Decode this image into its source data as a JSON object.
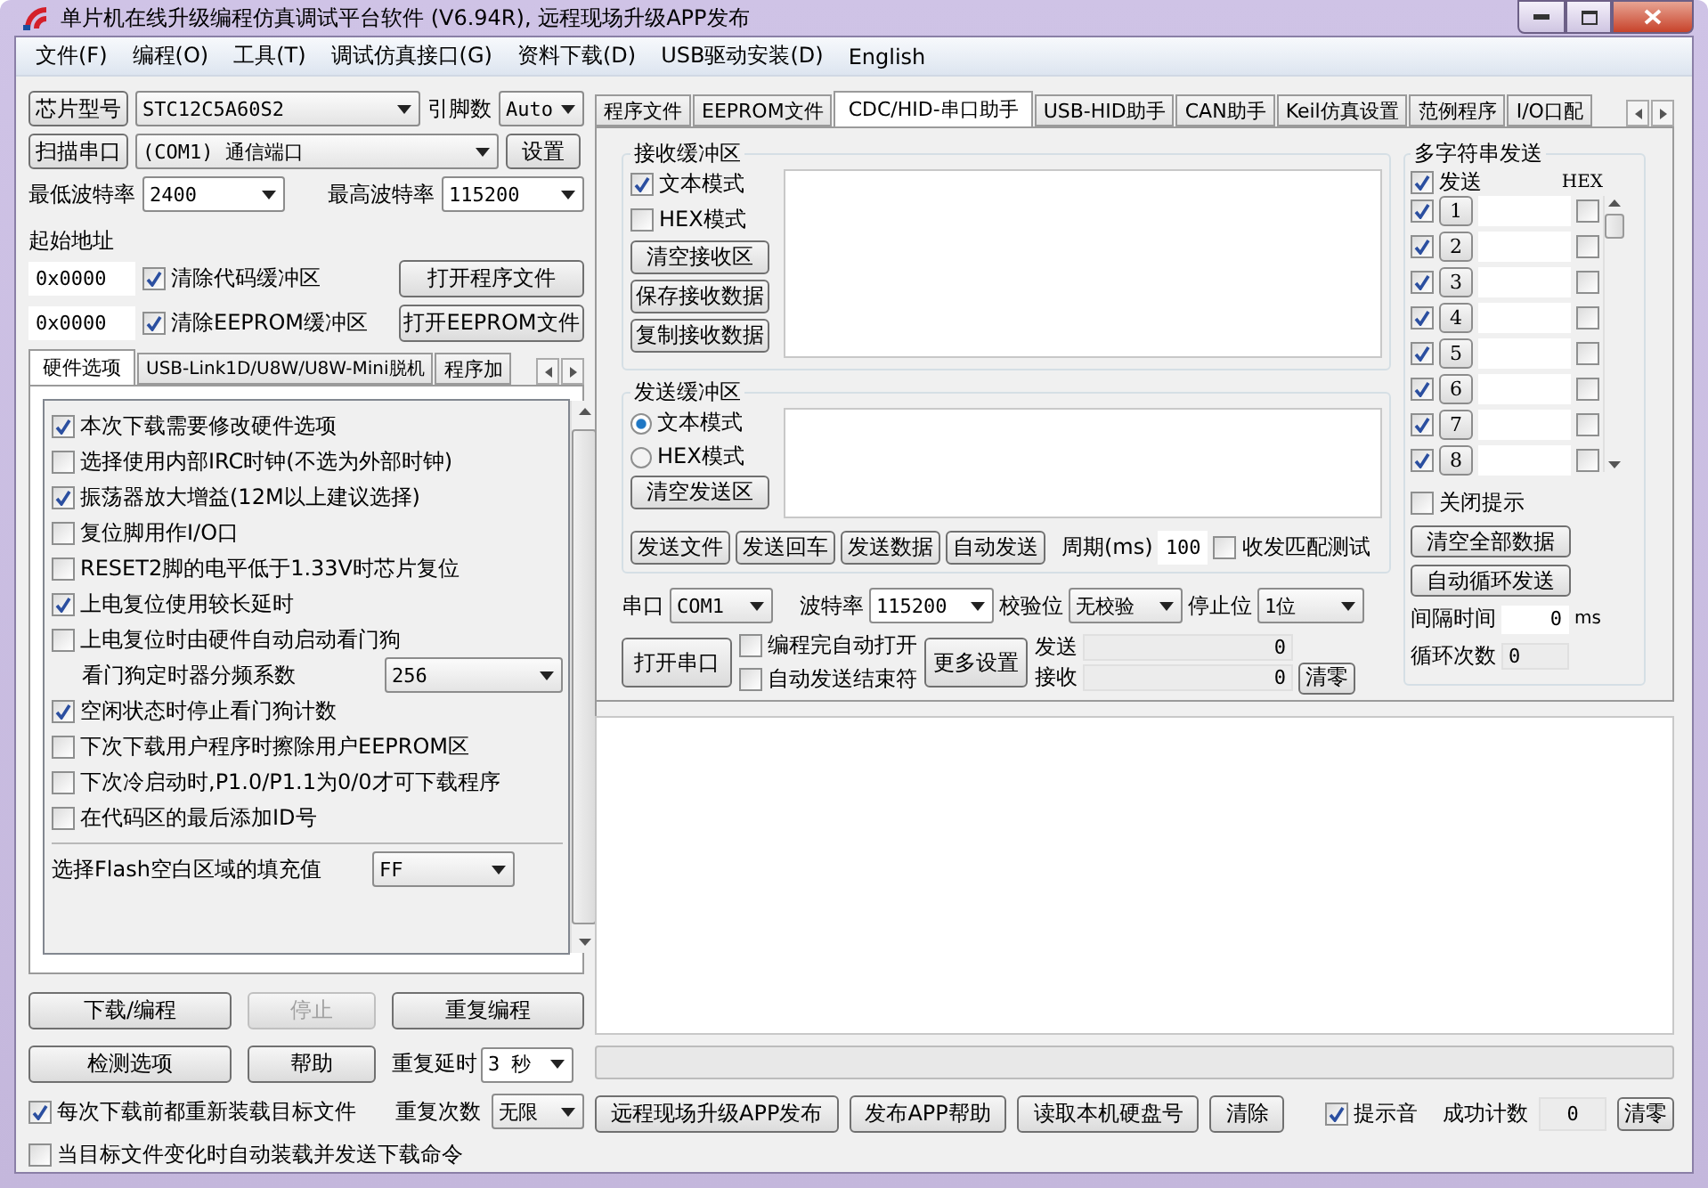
{
  "window": {
    "title": "单片机在线升级编程仿真调试平台软件 (V6.94R), 远程现场升级APP发布"
  },
  "menu": [
    "文件(F)",
    "编程(O)",
    "工具(T)",
    "调试仿真接口(G)",
    "资料下载(D)",
    "USB驱动安装(D)",
    "English"
  ],
  "chip": {
    "button": "芯片型号",
    "value": "STC12C5A60S2",
    "pins_label": "引脚数",
    "pins": "Auto"
  },
  "port": {
    "button": "扫描串口",
    "value": "(COM1) 通信端口",
    "settings": "设置"
  },
  "baud": {
    "min_label": "最低波特率",
    "min": "2400",
    "max_label": "最高波特率",
    "max": "115200"
  },
  "start_address": {
    "label": "起始地址",
    "rows": [
      {
        "address": "0x0000",
        "label": "清除代码缓冲区",
        "checked": true,
        "button": "打开程序文件"
      },
      {
        "address": "0x0000",
        "label": "清除EEPROM缓冲区",
        "checked": true,
        "button": "打开EEPROM文件"
      }
    ]
  },
  "left_tabs": [
    {
      "label": "硬件选项",
      "selected": true
    },
    {
      "label": "USB-Link1D/U8W/U8W-Mini脱机",
      "selected": false
    },
    {
      "label": "程序加",
      "selected": false
    }
  ],
  "hardware_options": [
    {
      "kind": "checkbox",
      "label": "本次下载需要修改硬件选项",
      "checked": true
    },
    {
      "kind": "checkbox",
      "label": "选择使用内部IRC时钟(不选为外部时钟)",
      "checked": false
    },
    {
      "kind": "checkbox",
      "label": "振荡器放大增益(12M以上建议选择)",
      "checked": true
    },
    {
      "kind": "checkbox",
      "label": "复位脚用作I/O口",
      "checked": false
    },
    {
      "kind": "checkbox",
      "label": "RESET2脚的电平低于1.33V时芯片复位",
      "checked": false
    },
    {
      "kind": "checkbox",
      "label": "上电复位使用较长延时",
      "checked": true
    },
    {
      "kind": "checkbox",
      "label": "上电复位时由硬件自动启动看门狗",
      "checked": false
    },
    {
      "kind": "select",
      "label": "看门狗定时器分频系数",
      "value": "256"
    },
    {
      "kind": "checkbox",
      "label": "空闲状态时停止看门狗计数",
      "checked": true
    },
    {
      "kind": "checkbox",
      "label": "下次下载用户程序时擦除用户EEPROM区",
      "checked": false
    },
    {
      "kind": "checkbox",
      "label": "下次冷启动时,P1.0/P1.1为0/0才可下载程序",
      "checked": false
    },
    {
      "kind": "checkbox",
      "label": "在代码区的最后添加ID号",
      "checked": false
    }
  ],
  "fill_value": {
    "label": "选择Flash空白区域的填充值",
    "value": "FF"
  },
  "actions": [
    {
      "label": "下载/编程",
      "disabled": false
    },
    {
      "label": "停止",
      "disabled": true
    },
    {
      "label": "重复编程",
      "disabled": false
    },
    {
      "label": "检测选项",
      "disabled": false
    },
    {
      "label": "帮助",
      "disabled": false
    }
  ],
  "repeat_delay": {
    "label": "重复延时",
    "value": "3 秒"
  },
  "repeat_count": {
    "label": "重复次数",
    "value": "无限"
  },
  "reload_options": [
    {
      "label": "每次下载前都重新装载目标文件",
      "checked": true
    },
    {
      "label": "当目标文件变化时自动装载并发送下载命令",
      "checked": false
    }
  ],
  "right_tabs": [
    {
      "label": "程序文件",
      "selected": false
    },
    {
      "label": "EEPROM文件",
      "selected": false
    },
    {
      "label": "CDC/HID-串口助手",
      "selected": true
    },
    {
      "label": "USB-HID助手",
      "selected": false
    },
    {
      "label": "CAN助手",
      "selected": false
    },
    {
      "label": "Keil仿真设置",
      "selected": false
    },
    {
      "label": "范例程序",
      "selected": false
    },
    {
      "label": "I/O口配",
      "selected": false
    }
  ],
  "receive": {
    "title": "接收缓冲区",
    "modes": [
      {
        "label": "文本模式",
        "checked": true
      },
      {
        "label": "HEX模式",
        "checked": false
      }
    ],
    "buttons": [
      "清空接收区",
      "保存接收数据",
      "复制接收数据"
    ]
  },
  "send": {
    "title": "发送缓冲区",
    "modes": [
      {
        "label": "文本模式",
        "selected": true
      },
      {
        "label": "HEX模式",
        "selected": false
      }
    ],
    "clear": "清空发送区",
    "buttons": [
      "发送文件",
      "发送回车",
      "发送数据",
      "自动发送"
    ],
    "period_label": "周期(ms)",
    "period": "100",
    "match": {
      "label": "收发匹配测试",
      "checked": false
    }
  },
  "serial": {
    "port_label": "串口",
    "port": "COM1",
    "baud_label": "波特率",
    "baud": "115200",
    "parity_label": "校验位",
    "parity": "无校验",
    "stop_label": "停止位",
    "stop": "1位",
    "open": "打开串口",
    "options": [
      {
        "label": "编程完自动打开",
        "checked": false
      },
      {
        "label": "自动发送结束符",
        "checked": false
      }
    ],
    "more": "更多设置",
    "counters": [
      {
        "label": "发送",
        "value": "0"
      },
      {
        "label": "接收",
        "value": "0"
      }
    ],
    "clear": "清零"
  },
  "multi_send": {
    "title": "多字符串发送",
    "send_label": "发送",
    "send_checked": true,
    "hex_label": "HEX",
    "rows": [
      {
        "button": "1",
        "checked": true,
        "hex": false
      },
      {
        "button": "2",
        "checked": true,
        "hex": false
      },
      {
        "button": "3",
        "checked": true,
        "hex": false
      },
      {
        "button": "4",
        "checked": true,
        "hex": false
      },
      {
        "button": "5",
        "checked": true,
        "hex": false
      },
      {
        "button": "6",
        "checked": true,
        "hex": false
      },
      {
        "button": "7",
        "checked": true,
        "hex": false
      },
      {
        "button": "8",
        "checked": true,
        "hex": false
      }
    ],
    "close_tip": {
      "label": "关闭提示",
      "checked": false
    },
    "buttons": [
      "清空全部数据",
      "自动循环发送"
    ],
    "interval_label": "间隔时间",
    "interval": "0",
    "interval_unit": "ms",
    "loop_label": "循环次数",
    "loop": "0"
  },
  "progress": {
    "level": 0
  },
  "bottom": {
    "buttons": [
      "远程现场升级APP发布",
      "发布APP帮助",
      "读取本机硬盘号",
      "清除"
    ],
    "beep": {
      "label": "提示音",
      "checked": true
    },
    "success_label": "成功计数",
    "success": "0",
    "clear": "清零"
  }
}
